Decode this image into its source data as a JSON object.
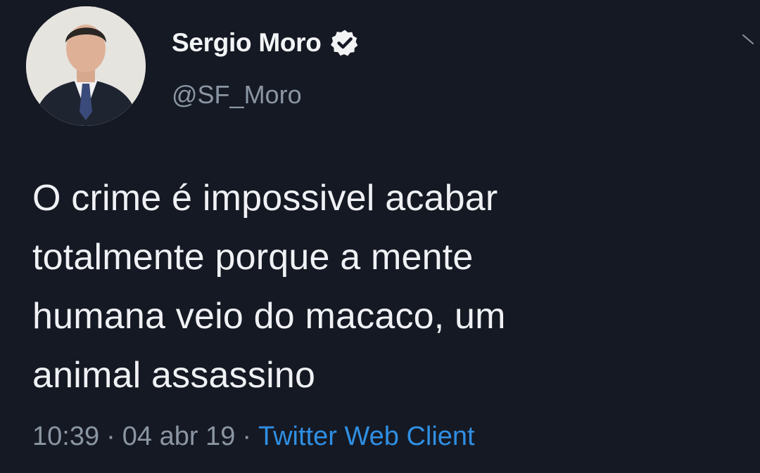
{
  "author": {
    "name": "Sergio Moro",
    "handle": "@SF_Moro",
    "verified_icon": "verified-badge-icon"
  },
  "tweet": {
    "lines": [
      "O crime é impossivel acabar",
      "totalmente porque a mente",
      "humana veio do macaco, um",
      "animal assassino"
    ]
  },
  "meta": {
    "time": "10:39",
    "separator": "·",
    "date": "04 abr 19",
    "source": "Twitter Web Client"
  },
  "colors": {
    "background": "#151924",
    "text": "#eff1f4",
    "secondary": "#8b96a3",
    "link": "#2f8fe3"
  }
}
